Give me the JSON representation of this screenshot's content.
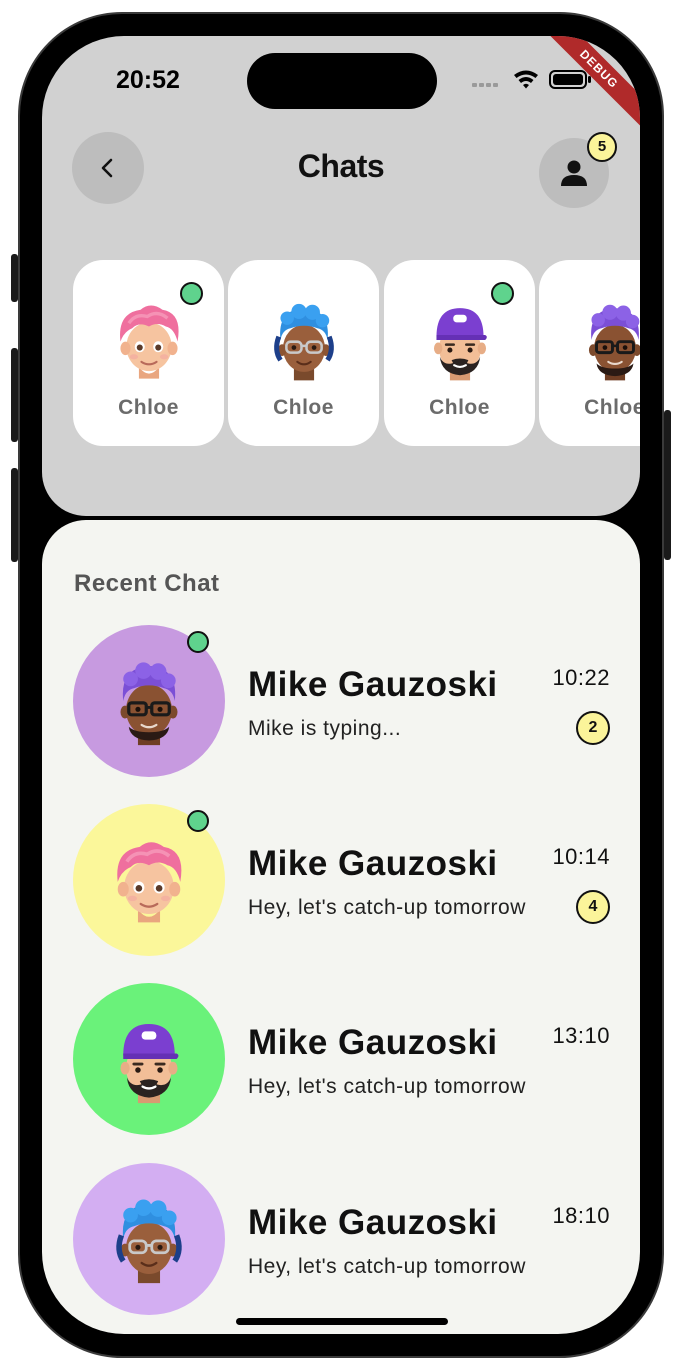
{
  "status_bar": {
    "time": "20:52",
    "debug_label": "DEBUG"
  },
  "header": {
    "title": "Chats",
    "notification_count": "5"
  },
  "stories": [
    {
      "name": "Chloe",
      "online": true,
      "avatar": "memoji-pink-hair"
    },
    {
      "name": "Chloe",
      "online": false,
      "avatar": "memoji-blue-hair-glasses"
    },
    {
      "name": "Chloe",
      "online": true,
      "avatar": "memoji-purple-cap-beard"
    },
    {
      "name": "Chloe",
      "online": false,
      "avatar": "memoji-purple-hair-glasses"
    }
  ],
  "recent": {
    "section_title": "Recent Chat",
    "chats": [
      {
        "name": "Mike Gauzoski",
        "preview": "Mike is typing...",
        "time": "10:22",
        "unread": "2",
        "online": true,
        "bg_color": "#c79ae0",
        "avatar": "memoji-purple-hair-glasses"
      },
      {
        "name": "Mike Gauzoski",
        "preview": "Hey, let's catch-up tomorrow",
        "time": "10:14",
        "unread": "4",
        "online": true,
        "bg_color": "#fbf79a",
        "avatar": "memoji-pink-hair"
      },
      {
        "name": "Mike Gauzoski",
        "preview": "Hey, let's catch-up tomorrow",
        "time": "13:10",
        "unread": "",
        "online": false,
        "bg_color": "#6af27a",
        "avatar": "memoji-purple-cap-beard"
      },
      {
        "name": "Mike Gauzoski",
        "preview": "Hey, let's catch-up tomorrow",
        "time": "18:10",
        "unread": "",
        "online": false,
        "bg_color": "#d3aef2",
        "avatar": "memoji-blue-hair-glasses"
      }
    ]
  },
  "colors": {
    "online": "#5fd38d",
    "badge": "#fbf49a",
    "top_panel": "#d1d1d1",
    "bottom_panel": "#f4f5f1"
  }
}
